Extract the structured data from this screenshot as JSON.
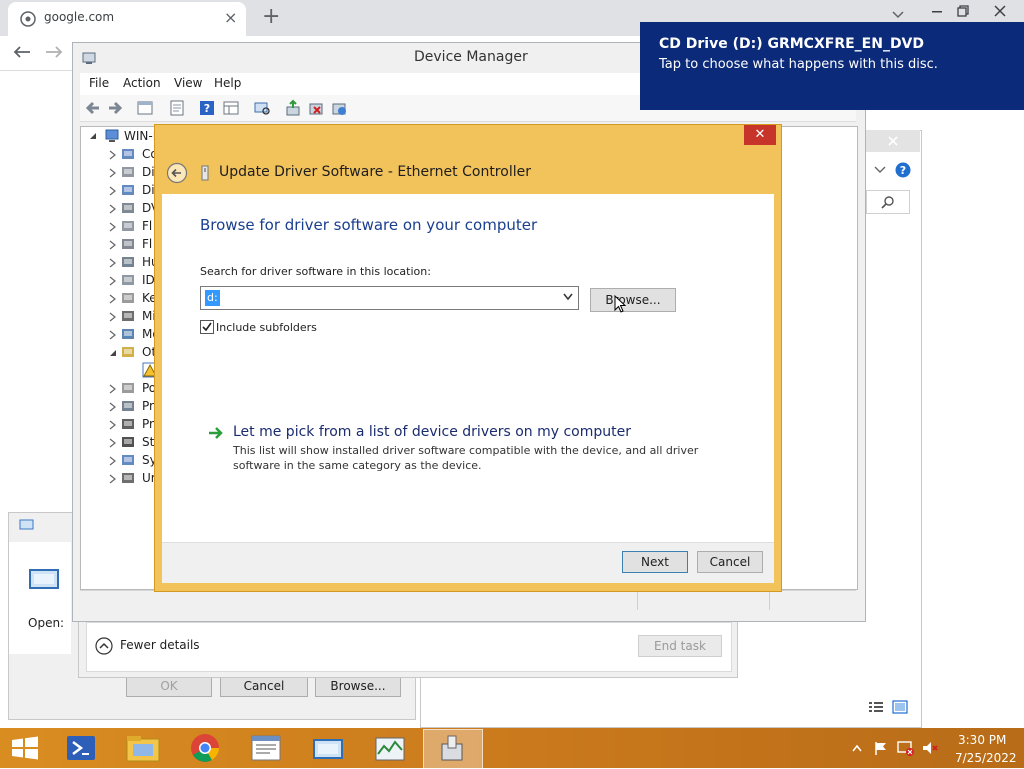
{
  "browser": {
    "tab_title": "google.com",
    "new_tab": "+",
    "close_tab": "×"
  },
  "toast": {
    "title": "CD Drive (D:) GRMCXFRE_EN_DVD",
    "message": "Tap to choose what happens with this disc."
  },
  "device_manager": {
    "title": "Device Manager",
    "menu": [
      "File",
      "Action",
      "View",
      "Help"
    ],
    "tree_root": "WIN-I",
    "tree_items": [
      "Co",
      "Di",
      "Di",
      "DV",
      "Fl",
      "Fl",
      "Hu",
      "ID",
      "Ke",
      "Mi",
      "Mo",
      "Ot",
      "",
      "Po",
      "Pr",
      "Pr",
      "St",
      "Sy",
      "Ur"
    ]
  },
  "update_driver": {
    "window_title": "Update Driver Software - Ethernet Controller",
    "heading": "Browse for driver software on your computer",
    "search_label": "Search for driver software in this location:",
    "path_value": "d:",
    "browse_label": "Browse...",
    "include_subfolders": "Include subfolders",
    "include_subfolders_checked": true,
    "pick_title": "Let me pick from a list of device drivers on my computer",
    "pick_desc_line1": "This list will show installed driver software compatible with the device, and all driver",
    "pick_desc_line2": "software in the same category as the device.",
    "next_label": "Next",
    "cancel_label": "Cancel",
    "close_symbol": "✕"
  },
  "task_manager": {
    "fewer_details": "Fewer details",
    "end_task": "End task"
  },
  "run_dialog": {
    "open_label": "Open:",
    "ok_label": "OK",
    "cancel_label": "Cancel",
    "browse_label": "Browse..."
  },
  "taskbar": {
    "time": "3:30 PM",
    "date": "7/25/2022"
  },
  "colors": {
    "toast_bg": "#0b2a7a",
    "dialog_frame": "#f2c25b",
    "accent_text": "#1a3f8f",
    "taskbar": "#d98d21"
  }
}
